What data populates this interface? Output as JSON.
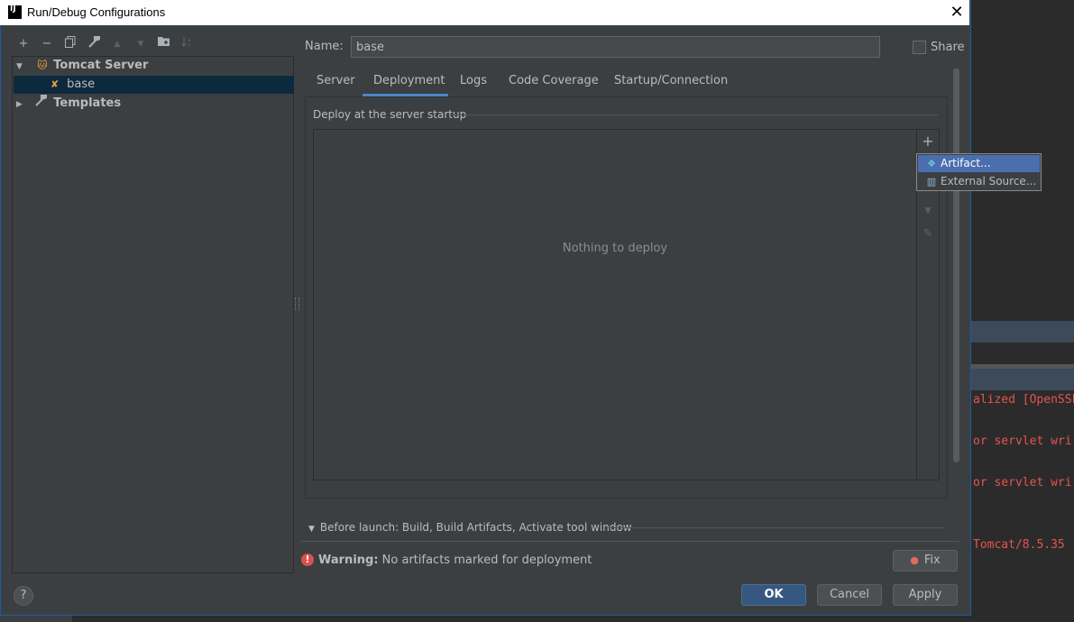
{
  "window": {
    "title": "Run/Debug Configurations",
    "close": "✕",
    "logo": "IJ"
  },
  "toolbar": {
    "add": "+",
    "remove": "−",
    "copy": "⎘",
    "edit": "🔧",
    "move_up": "▲",
    "move_down": "▼",
    "folder": "📁",
    "sort": "↓"
  },
  "tree": {
    "items": [
      {
        "label": "Tomcat Server",
        "icon": "tomcat-icon",
        "expanded": true
      },
      {
        "label": "base",
        "icon": "tomcat-config-icon"
      },
      {
        "label": "Templates",
        "icon": "wrench-icon",
        "expanded": false
      }
    ]
  },
  "form": {
    "name_label": "Name:",
    "name_value": "base",
    "share_label": "Share"
  },
  "tabs": [
    "Server",
    "Deployment",
    "Logs",
    "Code Coverage",
    "Startup/Connection"
  ],
  "deployment": {
    "section_label": "Deploy at the server startup",
    "empty_text": "Nothing to deploy",
    "side": {
      "add": "+",
      "down": "▼",
      "edit": "✎"
    }
  },
  "popup": {
    "items": [
      {
        "label": "Artifact...",
        "icon": "artifact-icon"
      },
      {
        "label": "External Source...",
        "icon": "external-source-icon"
      }
    ]
  },
  "before_launch": "Before launch: Build, Build Artifacts, Activate tool window",
  "warning": {
    "bold": "Warning:",
    "text": "No artifacts marked for deployment",
    "icon": "!"
  },
  "buttons": {
    "fix": "Fix",
    "ok": "OK",
    "cancel": "Cancel",
    "apply": "Apply",
    "help": "?"
  },
  "console": {
    "lines": [
      "alized [OpenSSL",
      "or servlet wri",
      "or servlet wri",
      "Tomcat/8.5.35"
    ]
  },
  "colors": {
    "accent": "#4a88c7",
    "selection": "#4b6eaf",
    "warning": "#d9524e",
    "console_text": "#e4544f"
  }
}
